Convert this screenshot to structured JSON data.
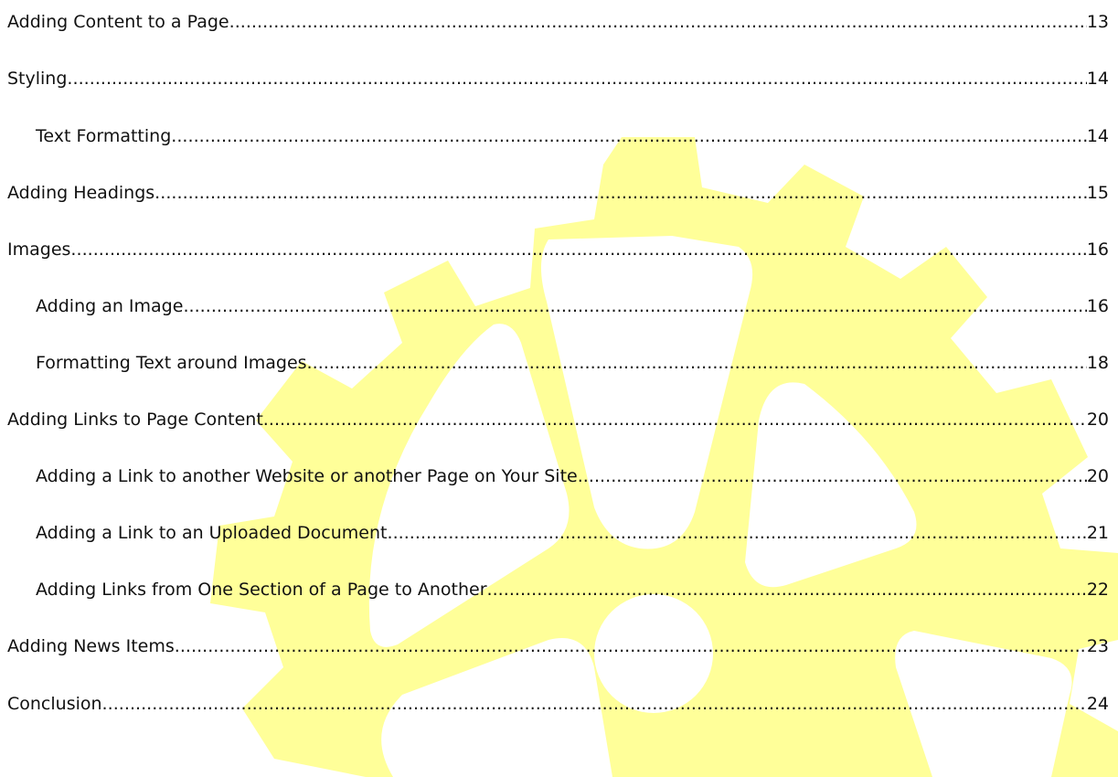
{
  "colors": {
    "watermark": "#ffff99",
    "text": "#111111",
    "background": "#ffffff"
  },
  "watermark": {
    "icon": "gear-icon"
  },
  "toc": {
    "entries": [
      {
        "title": "Adding Content to a Page",
        "page": "13",
        "level": 1
      },
      {
        "title": "Styling",
        "page": "14",
        "level": 1
      },
      {
        "title": "Text Formatting",
        "page": "14",
        "level": 2
      },
      {
        "title": "Adding Headings",
        "page": "15",
        "level": 1
      },
      {
        "title": "Images",
        "page": "16",
        "level": 1
      },
      {
        "title": "Adding an Image",
        "page": "16",
        "level": 2
      },
      {
        "title": "Formatting Text around Images",
        "page": "18",
        "level": 2
      },
      {
        "title": "Adding Links to Page Content",
        "page": "20",
        "level": 1
      },
      {
        "title": "Adding a Link to another Website or another Page on Your Site",
        "page": "20",
        "level": 2
      },
      {
        "title": "Adding a Link to an Uploaded Document",
        "page": "21",
        "level": 2
      },
      {
        "title": "Adding Links from One Section of a Page to Another",
        "page": "22",
        "level": 2
      },
      {
        "title": "Adding News Items",
        "page": "23",
        "level": 1
      },
      {
        "title": "Conclusion",
        "page": "24",
        "level": 1
      }
    ]
  }
}
